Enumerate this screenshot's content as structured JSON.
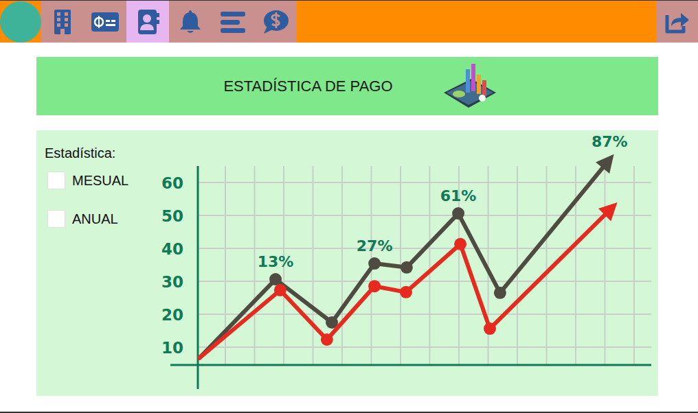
{
  "topbar": {
    "nav": [
      {
        "selected": false
      },
      {
        "selected": false
      },
      {
        "selected": true
      },
      {
        "selected": false
      },
      {
        "selected": false
      },
      {
        "selected": false
      }
    ]
  },
  "header": {
    "title": "ESTADÍSTICA DE PAGO"
  },
  "filters": {
    "label": "Estadística:",
    "options": [
      {
        "label": "MESUAL",
        "checked": false
      },
      {
        "label": "ANUAL",
        "checked": false
      }
    ]
  },
  "chart": {
    "y_ticks": [
      "60",
      "50",
      "40",
      "30",
      "20",
      "10"
    ],
    "series": [
      {
        "color": "#4f4b40",
        "x": [
          0.05,
          2.66,
          4.59,
          6.05,
          7.15,
          8.92,
          10.35,
          14.1
        ],
        "values": [
          6.7,
          30.6,
          17.5,
          35.4,
          34.2,
          50.6,
          26.5,
          67
        ]
      },
      {
        "color": "#e52b1f",
        "x": [
          0.05,
          2.82,
          4.42,
          6.05,
          7.13,
          8.99,
          10.0,
          14.2
        ],
        "values": [
          6.7,
          27.3,
          12.3,
          28.5,
          26.7,
          41.3,
          15.6,
          52.5
        ]
      }
    ],
    "annotations": [
      {
        "text": "13%",
        "series": 0,
        "point": 1
      },
      {
        "text": "27%",
        "series": 0,
        "point": 3
      },
      {
        "text": "61%",
        "series": 0,
        "point": 5
      },
      {
        "text": "87%",
        "series": 0,
        "point": 7
      }
    ]
  }
}
